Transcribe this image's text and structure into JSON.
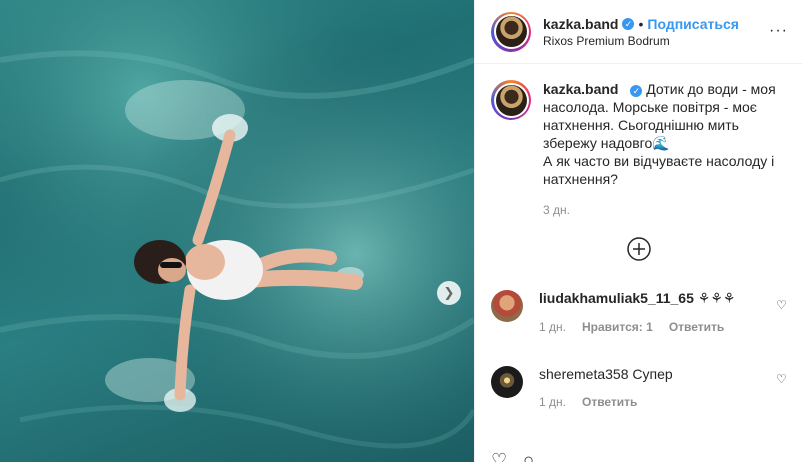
{
  "header": {
    "username": "kazka.band",
    "separator": "•",
    "follow_label": "Подписаться",
    "location": "Rixos Premium Bodrum",
    "more_label": "···"
  },
  "caption": {
    "username": "kazka.band",
    "text_lines": [
      "Дотик до води - моя",
      "насолода. Морське повітря - моє",
      "натхнення. Сьогоднішню мить",
      "збережу надовго🌊",
      "А як часто ви відчуваєте насолоду і",
      "натхнення?"
    ],
    "time": "3 дн."
  },
  "load_more": {
    "label": "+"
  },
  "comments": [
    {
      "username": "liudakhamuliak5_11_65",
      "text": "⚘⚘⚘",
      "time": "1 дн.",
      "likes": "Нравится: 1",
      "reply": "Ответить"
    },
    {
      "username": "sheremeta358",
      "text": "Супер",
      "time": "1 дн.",
      "reply": "Ответить"
    }
  ],
  "colors": {
    "accent": "#3897f0",
    "text": "#262626",
    "muted": "#8e8e8e",
    "water": "#2a7f82"
  }
}
